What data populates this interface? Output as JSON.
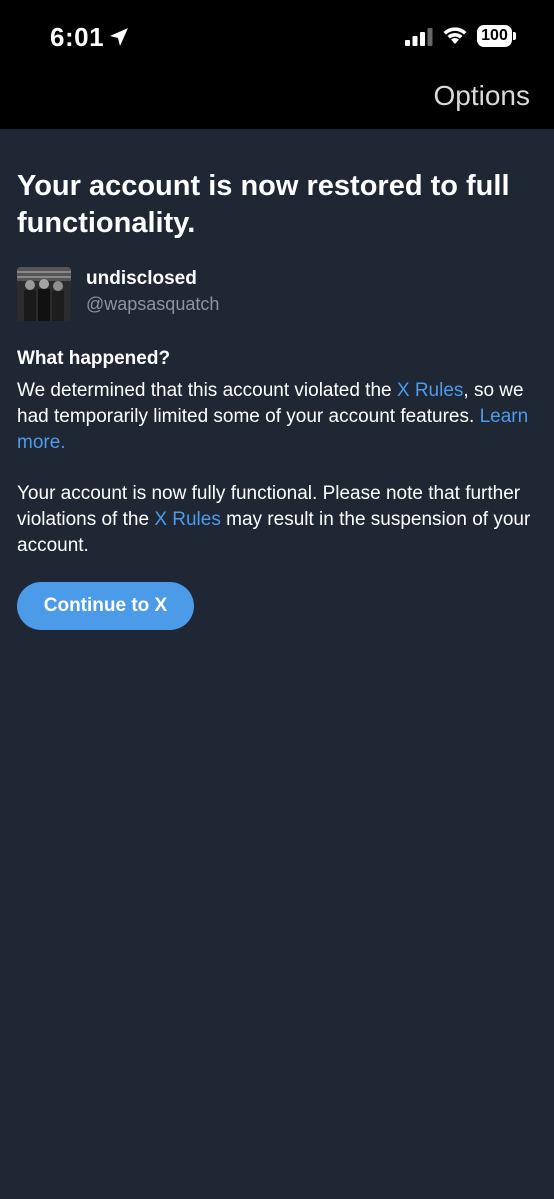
{
  "status_bar": {
    "time": "6:01",
    "battery": "100"
  },
  "header": {
    "options_label": "Options"
  },
  "main": {
    "title": "Your account is now restored to full functionality.",
    "account": {
      "name": "undisclosed",
      "handle": "@wapsasquatch"
    },
    "what_happened_heading": "What happened?",
    "paragraph1": {
      "before_link": "We determined that this account violated the ",
      "rules_link": "X Rules",
      "after_link": ", so we had temporarily limited some of your account features. ",
      "learn_more": "Learn more."
    },
    "paragraph2": {
      "before_link": "Your account is now fully functional. Please note that further violations of the ",
      "rules_link": "X Rules",
      "after_link": " may result in the suspension of your account."
    },
    "continue_button": "Continue to X"
  },
  "colors": {
    "background": "#1f2735",
    "link": "#4d9be9",
    "button": "#4c9be8"
  }
}
